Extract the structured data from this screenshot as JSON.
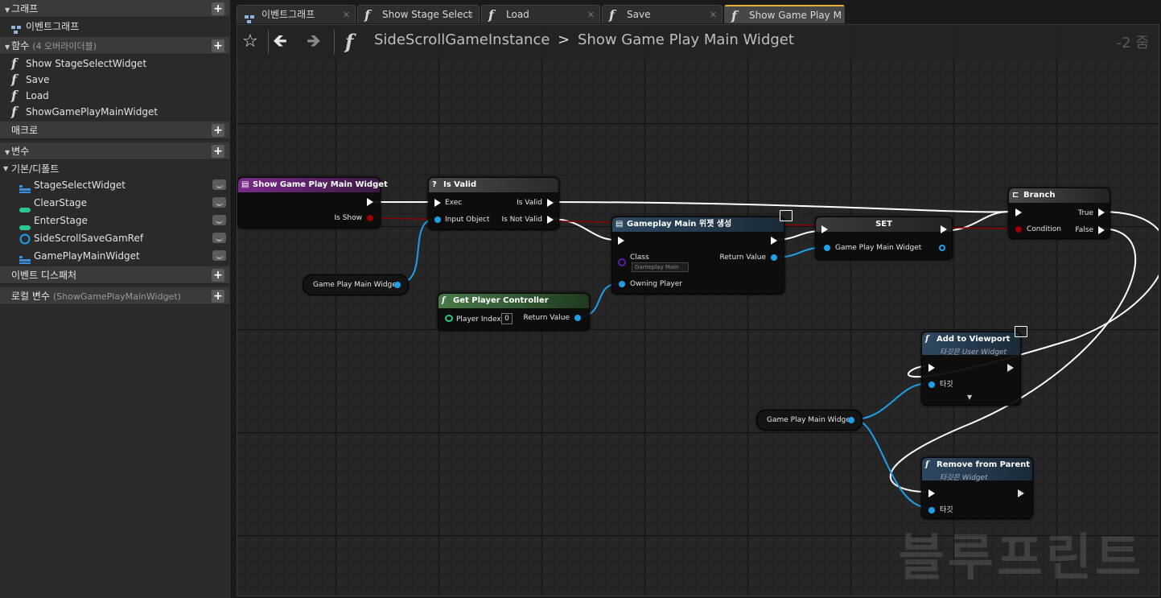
{
  "left_panel": {
    "graph_header": "그래프",
    "event_graph": "이벤트그래프",
    "functions_header": "함수",
    "functions_sub": "(4 오버라이더블)",
    "functions": [
      "Show StageSelectWidget",
      "Save",
      "Load",
      "ShowGamePlayMainWidget"
    ],
    "macros_header": "매크로",
    "variables_header": "변수",
    "defaults_header": "기본/디폴트",
    "variables": [
      {
        "name": "StageSelectWidget",
        "color": "#3a8fd8",
        "icon": "object-ref-icon"
      },
      {
        "name": "ClearStage",
        "color": "#2cc88a",
        "icon": "integer-pill-icon"
      },
      {
        "name": "EnterStage",
        "color": "#2cc88a",
        "icon": "integer-pill-icon"
      },
      {
        "name": "SideScrollSaveGamRef",
        "color": "#1e9fe8",
        "icon": "ring-icon"
      },
      {
        "name": "GamePlayMainWidget",
        "color": "#3a8fd8",
        "icon": "object-ref-icon"
      }
    ],
    "dispatchers_header": "이벤트 디스패처",
    "locals_header": "로컬 변수",
    "locals_sub": "(ShowGamePlayMainWidget)"
  },
  "tabs": [
    {
      "label": "이벤트그래프",
      "icon": "event-graph-icon"
    },
    {
      "label": "Show Stage Select",
      "icon": "function-icon"
    },
    {
      "label": "Load",
      "icon": "function-icon"
    },
    {
      "label": "Save",
      "icon": "function-icon"
    },
    {
      "label": "Show Game Play M",
      "icon": "function-icon",
      "active": true
    }
  ],
  "toolbar": {
    "breadcrumb_class": "SideScrollGameInstance",
    "breadcrumb_sep": ">",
    "breadcrumb_function": "Show Game Play Main Widget",
    "zoom": "-2 줌"
  },
  "watermark": "블루프린트",
  "nodes": {
    "entry": {
      "title": "Show Game Play Main Widget",
      "pin_is_show": "Is Show"
    },
    "is_valid": {
      "title": "Is Valid",
      "exec": "Exec",
      "input_object": "Input Object",
      "is_valid": "Is Valid",
      "is_not_valid": "Is Not Valid"
    },
    "create_widget": {
      "title": "Gameplay Main 위젯 생성",
      "class": "Class",
      "class_value": "Gameplay Main",
      "return_value": "Return Value",
      "owning_player": "Owning Player"
    },
    "set": {
      "title": "SET",
      "pin": "Game Play Main Widget"
    },
    "branch": {
      "title": "Branch",
      "condition": "Condition",
      "true": "True",
      "false": "False"
    },
    "get_pc": {
      "title": "Get Player Controller",
      "player_index": "Player Index",
      "index_value": "0",
      "return_value": "Return Value"
    },
    "var_get_1": {
      "label": "Game Play Main Widget"
    },
    "var_get_2": {
      "label": "Game Play Main Widget"
    },
    "add_viewport": {
      "title": "Add to Viewport",
      "subtitle": "타깃은 User Widget",
      "target": "타깃"
    },
    "remove_parent": {
      "title": "Remove from Parent",
      "subtitle": "타깃은 Widget",
      "target": "타깃"
    }
  },
  "colors": {
    "exec": "#ffffff",
    "object_pin": "#1e9fe8",
    "bool_pin": "#9a0000",
    "class_pin": "#5b1fa8",
    "entry_header": "#6b2a7a",
    "pure_header": "#3d6b3d",
    "func_header": "#2e4860",
    "macro_header": "#3a3a3a"
  }
}
